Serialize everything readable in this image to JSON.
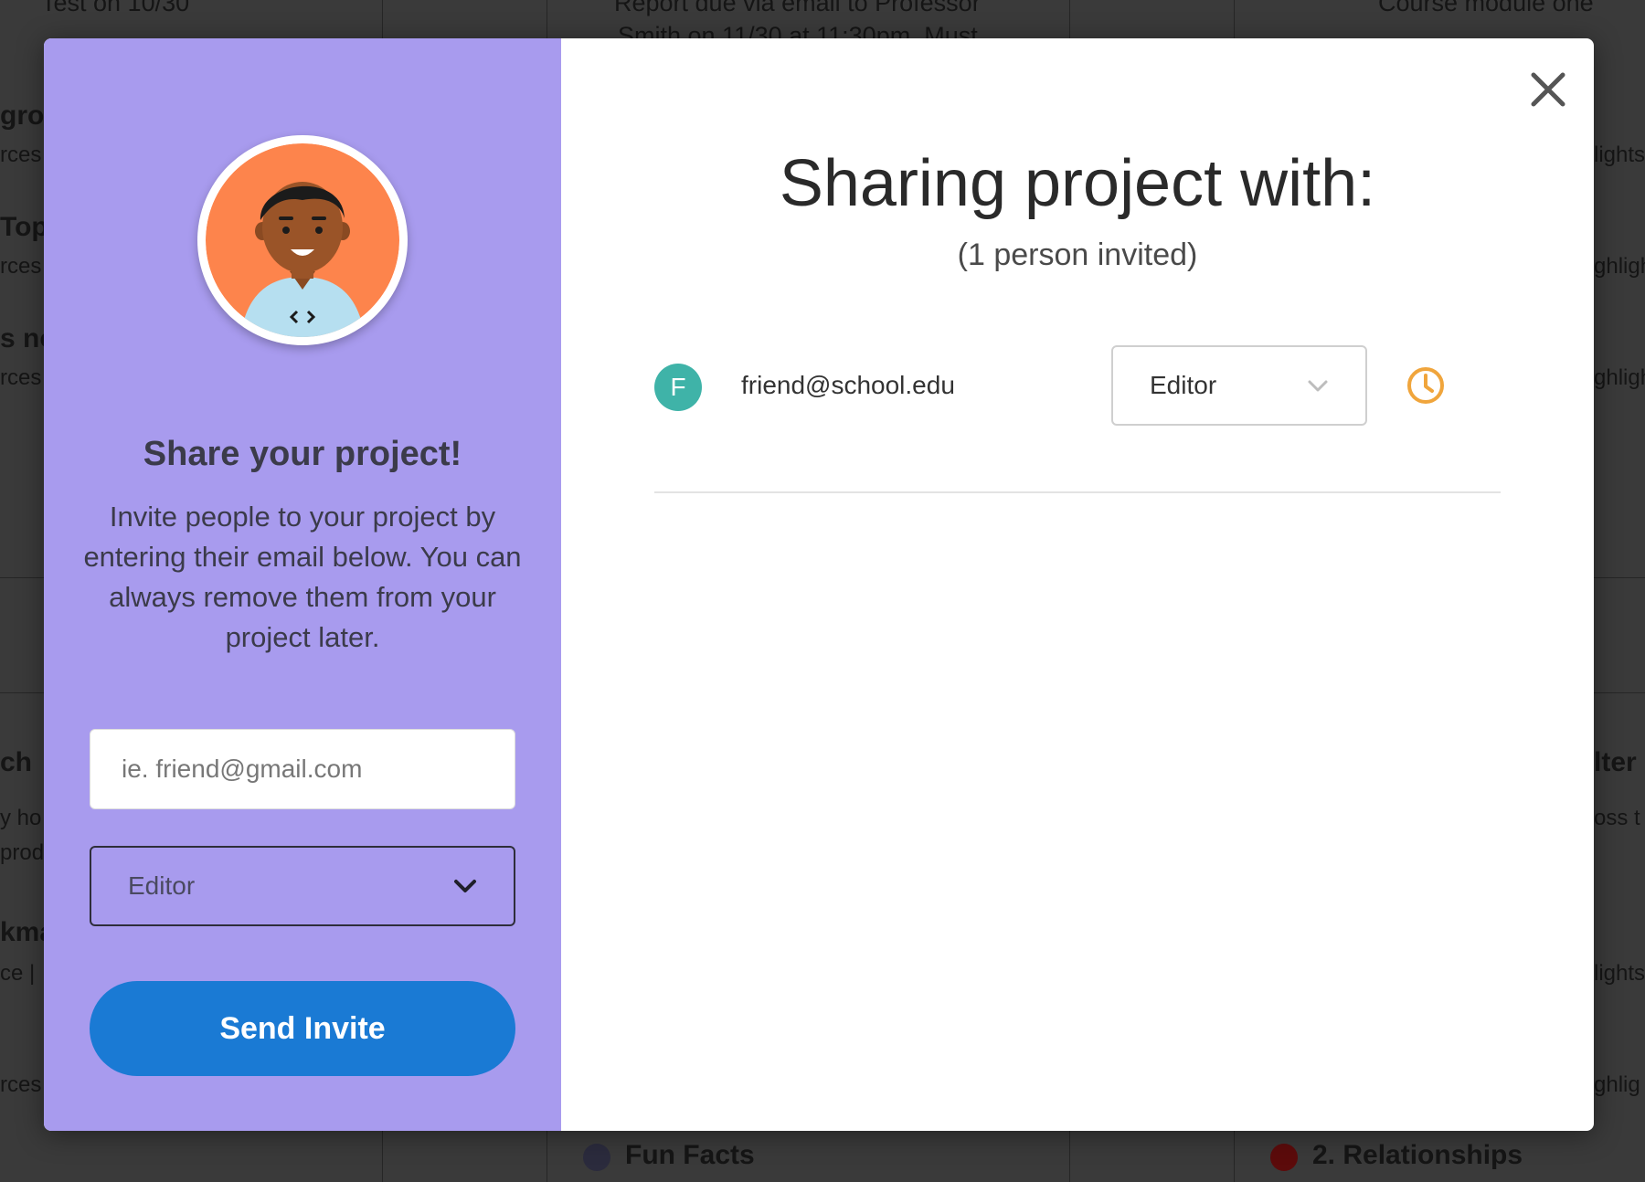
{
  "background_page": {
    "top_texts": [
      "Test on 10/30",
      "Report due via email to Professor",
      "Smith on 11/30 at 11:30pm. Must",
      "Course module one"
    ],
    "left_fragments": [
      "gro",
      "rces",
      "Top",
      "rces",
      "s no",
      "rces",
      "ch",
      "y ho",
      "prod",
      "kma",
      "ce |",
      "rces"
    ],
    "right_fragments": [
      "lights",
      "ghligh",
      "ghligh",
      "lter",
      "oss t",
      "lights",
      "ghlig"
    ],
    "bottom_items": [
      {
        "label": "Fun Facts",
        "color": "#2b2b3d"
      },
      {
        "label": "2. Relationships",
        "color": "#5c0b0b"
      }
    ]
  },
  "modal": {
    "left_panel": {
      "avatar": "developer-avatar",
      "title": "Share your project!",
      "description": "Invite people to your project by entering their email below. You can always remove them from your project later.",
      "email_input": {
        "placeholder": "ie. friend@gmail.com",
        "value": ""
      },
      "role_select": {
        "selected": "Editor"
      },
      "send_button": "Send Invite",
      "panel_color": "#a89bee",
      "button_color": "#1a7ad4"
    },
    "right_panel": {
      "heading": "Sharing project with:",
      "subheading": "(1 person invited)",
      "members": [
        {
          "initial": "F",
          "email": "friend@school.edu",
          "role": "Editor",
          "status_icon": "clock-icon",
          "avatar_color": "#3fb3a8",
          "status_color": "#f0a53c"
        }
      ]
    },
    "close_icon": "close-icon"
  }
}
